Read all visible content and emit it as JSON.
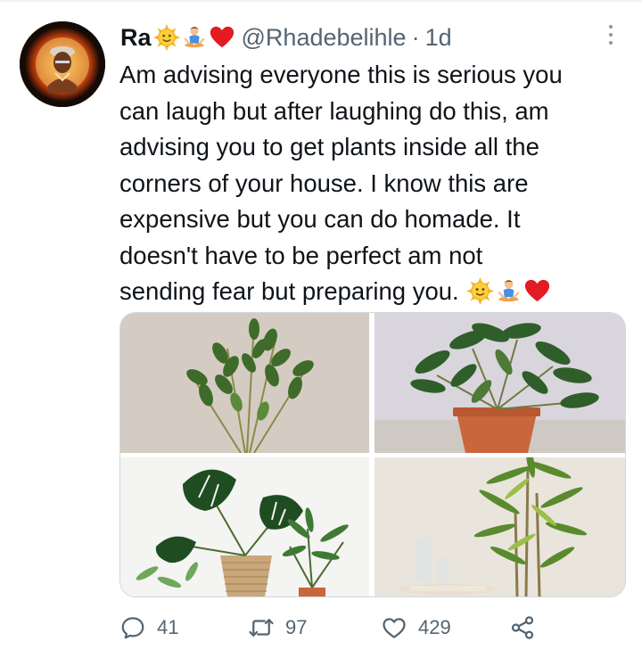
{
  "tweet": {
    "display_name": "Ra",
    "name_emojis": [
      "sun-with-face-icon",
      "person-in-lotus-position-icon",
      "red-heart-icon"
    ],
    "handle": "@Rhadebelihle",
    "separator": "·",
    "time": "1d",
    "text_lines": [
      "Am advising everyone this is serious you",
      "can laugh but after laughing do this, am",
      "advising you to get plants inside all the",
      "corners of your house. I know this are",
      "expensive but you can do homade. It",
      "doesn't have to be perfect am not",
      "sending fear but preparing you."
    ],
    "text_end_emojis": [
      "sun-with-face-icon",
      "person-in-lotus-position-icon",
      "red-heart-icon"
    ],
    "media": [
      {
        "subject": "zz-plant-photo"
      },
      {
        "subject": "umbrella-plant-in-terracotta-pot-photo"
      },
      {
        "subject": "monstera-and-palm-group-photo"
      },
      {
        "subject": "dracaena-stalk-plant-photo"
      }
    ],
    "actions": {
      "reply": {
        "icon": "reply-icon",
        "count": "41"
      },
      "retweet": {
        "icon": "retweet-icon",
        "count": "97"
      },
      "like": {
        "icon": "heart-outline-icon",
        "count": "429"
      },
      "share": {
        "icon": "share-icon"
      }
    }
  },
  "colors": {
    "text": "#0f1419",
    "secondary": "#536471",
    "border": "#cfd9de"
  }
}
